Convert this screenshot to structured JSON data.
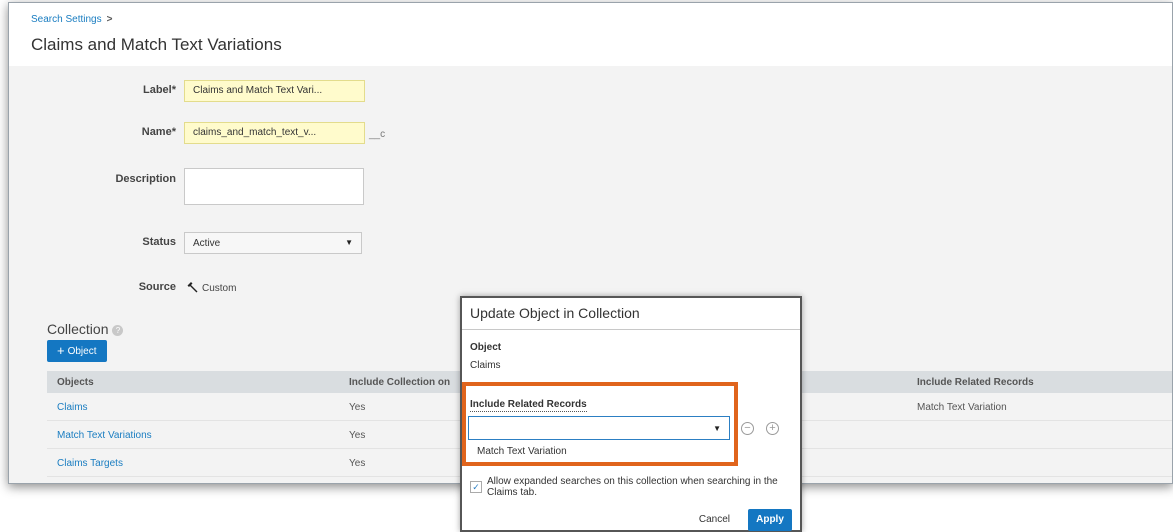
{
  "breadcrumb": {
    "link": "Search Settings",
    "separator": ">"
  },
  "page_title": "Claims and Match Text Variations",
  "form": {
    "label": {
      "title": "Label*",
      "value": "Claims and Match Text Vari..."
    },
    "name": {
      "title": "Name*",
      "value": "claims_and_match_text_v...",
      "suffix": "__c"
    },
    "description": {
      "title": "Description",
      "value": ""
    },
    "status": {
      "title": "Status",
      "value": "Active"
    },
    "source": {
      "title": "Source",
      "value": "Custom"
    }
  },
  "collection": {
    "title": "Collection",
    "info_icon": "?",
    "add_button": "Object",
    "columns": [
      "Objects",
      "Include Collection on",
      "Include Related Records"
    ],
    "rows": [
      {
        "object": "Claims",
        "include": "Yes",
        "related": "Match Text Variation"
      },
      {
        "object": "Match Text Variations",
        "include": "Yes",
        "related": ""
      },
      {
        "object": "Claims Targets",
        "include": "Yes",
        "related": ""
      }
    ]
  },
  "modal": {
    "title": "Update Object in Collection",
    "object_label": "Object",
    "object_value": "Claims",
    "related_label": "Include Related Records",
    "related_select_value": "",
    "related_option": "Match Text Variation",
    "checkbox_label": "Allow expanded searches on this collection when searching in the Claims tab.",
    "checkbox_checked": true,
    "cancel": "Cancel",
    "apply": "Apply"
  },
  "colors": {
    "accent": "#1477c2",
    "highlight": "#e0641c",
    "link": "#1a7dc1"
  },
  "icons": {
    "source": "hammer-icon",
    "remove": "minus-circle-icon",
    "add": "plus-circle-icon"
  }
}
